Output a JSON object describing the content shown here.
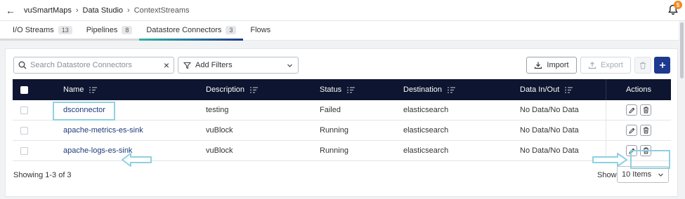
{
  "breadcrumb": {
    "items": [
      "vuSmartMaps",
      "Data Studio",
      "ContextStreams"
    ]
  },
  "notifications": {
    "count": "5"
  },
  "tabs": [
    {
      "label": "I/O Streams",
      "count": "13"
    },
    {
      "label": "Pipelines",
      "count": "8"
    },
    {
      "label": "Datastore Connectors",
      "count": "3"
    },
    {
      "label": "Flows",
      "count": ""
    }
  ],
  "toolbar": {
    "search_placeholder": "Search Datastore Connectors",
    "filters_label": "Add Filters",
    "import_label": "Import",
    "export_label": "Export"
  },
  "table": {
    "headers": {
      "name": "Name",
      "description": "Description",
      "status": "Status",
      "destination": "Destination",
      "data_io": "Data In/Out",
      "actions": "Actions"
    },
    "rows": [
      {
        "name": "dsconnector",
        "description": "testing",
        "status": "Failed",
        "destination": "elasticsearch",
        "data_io": "No Data/No Data"
      },
      {
        "name": "apache-metrics-es-sink",
        "description": "vuBlock",
        "status": "Running",
        "destination": "elasticsearch",
        "data_io": "No Data/No Data"
      },
      {
        "name": "apache-logs-es-sink",
        "description": "vuBlock",
        "status": "Running",
        "destination": "elasticsearch",
        "data_io": "No Data/No Data"
      }
    ]
  },
  "footer": {
    "showing": "Showing 1-3 of 3",
    "show_label": "Show",
    "page_size": "10 Items"
  },
  "colors": {
    "header_bg": "#0d1530",
    "accent_blue": "#1d3a8f",
    "highlight": "#8fd0e2",
    "badge": "#f08a1c"
  }
}
